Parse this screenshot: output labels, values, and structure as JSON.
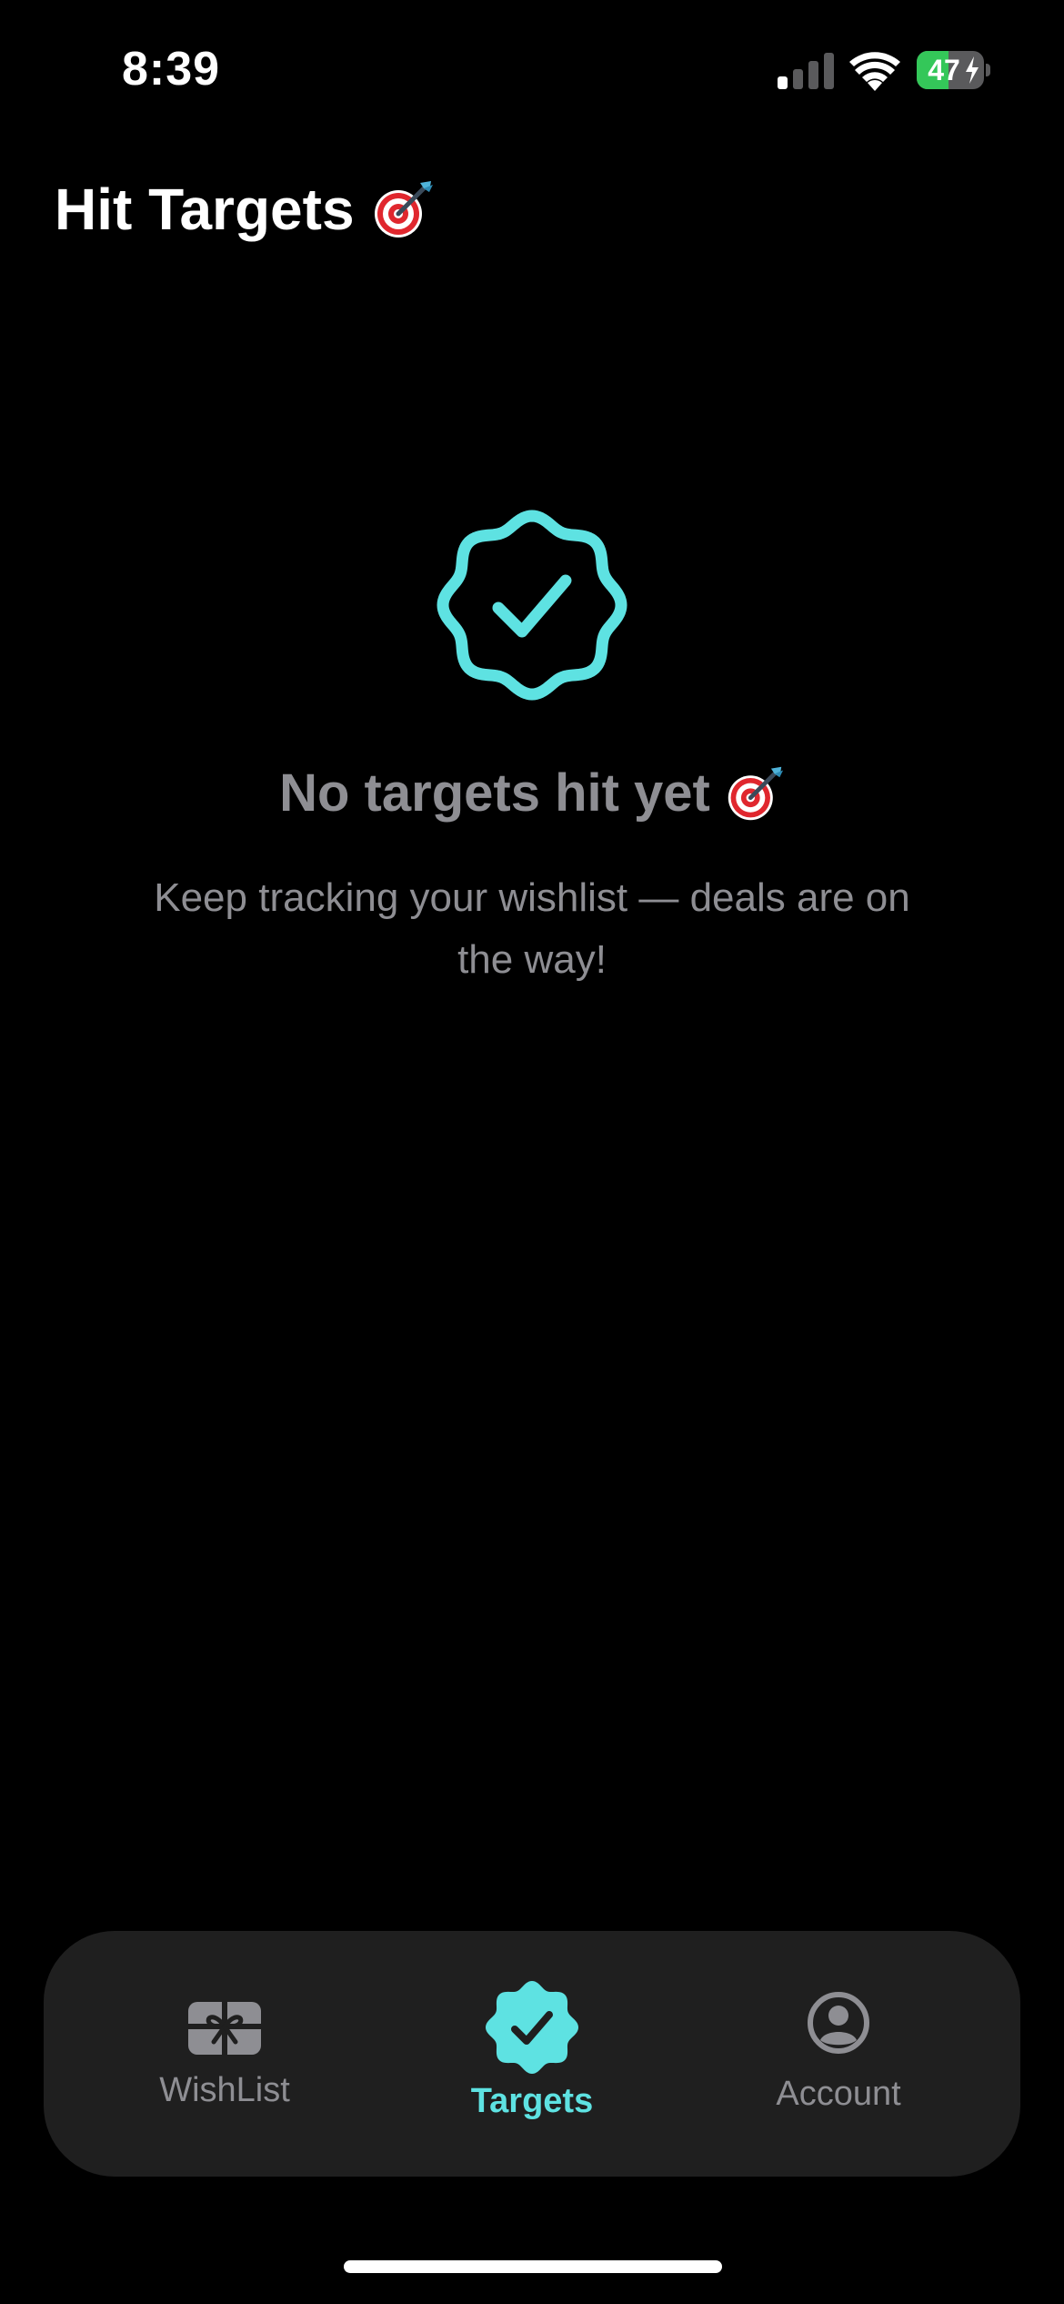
{
  "status_bar": {
    "time": "8:39",
    "battery_percent": "47",
    "battery_level": 0.47,
    "icons": [
      "signal-icon",
      "wifi-icon",
      "battery-icon"
    ]
  },
  "header": {
    "title": "Hit Targets",
    "title_emoji_icon": "dart-target-icon"
  },
  "empty_state": {
    "icon": "verified-badge-icon",
    "heading": "No targets hit yet",
    "heading_emoji_icon": "dart-target-icon",
    "subtitle": "Keep tracking your wishlist — deals are on the way!"
  },
  "tab_bar": {
    "tabs": [
      {
        "label": "WishList",
        "icon": "gift-icon",
        "active": false
      },
      {
        "label": "Targets",
        "icon": "verified-badge-icon",
        "active": true
      },
      {
        "label": "Account",
        "icon": "account-circle-icon",
        "active": false
      }
    ]
  },
  "colors": {
    "background": "#000000",
    "accent": "#5ee2e2",
    "muted_text": "#8e8e93",
    "tab_bar_bg": "#1f1f1f",
    "battery_green": "#34c759"
  }
}
